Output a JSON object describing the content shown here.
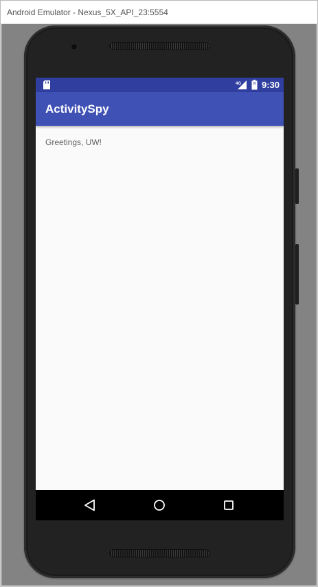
{
  "window": {
    "title": "Android Emulator - Nexus_5X_API_23:5554"
  },
  "status_bar": {
    "time": "9:30",
    "network_label": "4G",
    "icons": [
      "sd-card-icon",
      "signal-4g-icon",
      "battery-icon"
    ],
    "color": "#303f9f"
  },
  "app_bar": {
    "title": "ActivitySpy",
    "color": "#3f51b5"
  },
  "content": {
    "greeting": "Greetings, UW!"
  },
  "nav_bar": {
    "buttons": [
      "back-icon",
      "home-icon",
      "recents-icon"
    ]
  }
}
